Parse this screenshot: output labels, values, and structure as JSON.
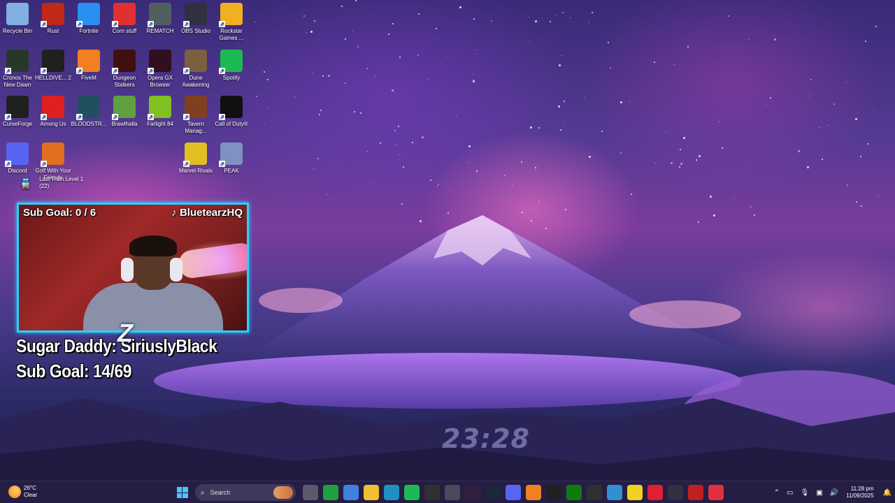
{
  "desktop": {
    "icons": [
      {
        "label": "Recycle Bin",
        "icon": "recycle-bin-icon",
        "color": "#7fb0e0"
      },
      {
        "label": "Rust",
        "icon": "rust-icon",
        "color": "#c02818"
      },
      {
        "label": "Fortnite",
        "icon": "fortnite-icon",
        "color": "#2a8ff0"
      },
      {
        "label": "Corn stuff",
        "icon": "power-icon",
        "color": "#e03030"
      },
      {
        "label": "REMATCH",
        "icon": "rematch-icon",
        "color": "#506060"
      },
      {
        "label": "OBS Studio",
        "icon": "obs-icon",
        "color": "#303040"
      },
      {
        "label": "Rockstar Games ...",
        "icon": "rockstar-icon",
        "color": "#f0b020"
      },
      {
        "label": "Cronos The New Dawn",
        "icon": "cronos-icon",
        "color": "#283828"
      },
      {
        "label": "HELLDIVE... 2",
        "icon": "helldivers-icon",
        "color": "#202020"
      },
      {
        "label": "FiveM",
        "icon": "fivem-icon",
        "color": "#f08020"
      },
      {
        "label": "Dungeon Stalkers",
        "icon": "dungeon-stalkers-icon",
        "color": "#401010"
      },
      {
        "label": "Opera GX Browser",
        "icon": "opera-gx-icon",
        "color": "#301020"
      },
      {
        "label": "Dune Awakening",
        "icon": "dune-icon",
        "color": "#7a6040"
      },
      {
        "label": "Spotify",
        "icon": "spotify-icon",
        "color": "#1db954"
      },
      {
        "label": "CurseForge",
        "icon": "curseforge-icon",
        "color": "#202020"
      },
      {
        "label": "Among Us",
        "icon": "among-us-icon",
        "color": "#e02020"
      },
      {
        "label": "BLOODSTR...",
        "icon": "bloodstrike-icon",
        "color": "#205060"
      },
      {
        "label": "Brawlhalla",
        "icon": "brawlhalla-icon",
        "color": "#60a040"
      },
      {
        "label": "Farlight 84",
        "icon": "farlight-icon",
        "color": "#80c020"
      },
      {
        "label": "Tavern Manag...",
        "icon": "tavern-icon",
        "color": "#804020"
      },
      {
        "label": "Call of Duty®",
        "icon": "call-of-duty-icon",
        "color": "#101010"
      },
      {
        "label": "Discord",
        "icon": "discord-icon",
        "color": "#5865f2"
      },
      {
        "label": "Golf With Your Friends",
        "icon": "golf-icon",
        "color": "#e07020"
      },
      {
        "label": "Marvel Rivals",
        "icon": "marvel-rivals-icon",
        "color": "#e0c020"
      },
      {
        "label": "PEAK",
        "icon": "peak-icon",
        "color": "#8090c0"
      },
      {
        "label": "Last Train Level 1  (22)",
        "icon": "train-icon",
        "color": "#3a3a5a"
      }
    ]
  },
  "stream_overlay": {
    "cam_sub_goal": "Sub Goal:  0 / 6",
    "cam_handle": "♪ BluetearzHQ",
    "line1": "Sugar Daddy: SiriuslyBlack",
    "line2": "Sub Goal: 14/69"
  },
  "wallpaper": {
    "clock": "23:28"
  },
  "taskbar": {
    "weather_temp": "26°C",
    "weather_desc": "Clear",
    "search_label": "Search",
    "pinned": [
      {
        "icon": "task-view-icon",
        "color": "#5a5a6a"
      },
      {
        "icon": "spreadsheet-icon",
        "color": "#20a040"
      },
      {
        "icon": "chrome-icon",
        "color": "#4080e0"
      },
      {
        "icon": "file-explorer-icon",
        "color": "#f0c030"
      },
      {
        "icon": "vscode-icon",
        "color": "#2090c0"
      },
      {
        "icon": "spotify-icon",
        "color": "#1db954"
      },
      {
        "icon": "epic-games-icon",
        "color": "#303030"
      },
      {
        "icon": "notepad-icon",
        "color": "#4a4a5a"
      },
      {
        "icon": "obs-icon",
        "color": "#302040"
      },
      {
        "icon": "steam-icon",
        "color": "#1b2838"
      },
      {
        "icon": "discord-icon",
        "color": "#5865f2"
      },
      {
        "icon": "vlc-icon",
        "color": "#f08020"
      },
      {
        "icon": "capcut-icon",
        "color": "#202020"
      },
      {
        "icon": "xbox-icon",
        "color": "#107c10"
      },
      {
        "icon": "steelseries-icon",
        "color": "#303030"
      },
      {
        "icon": "photos-icon",
        "color": "#3090d0"
      },
      {
        "icon": "sticky-notes-icon",
        "color": "#f0d020"
      },
      {
        "icon": "opera-icon",
        "color": "#e02030"
      },
      {
        "icon": "terminal-icon",
        "color": "#303040"
      },
      {
        "icon": "cc-icon",
        "color": "#c02020"
      },
      {
        "icon": "tf-icon",
        "color": "#e03040"
      }
    ],
    "time": "11:28 pm",
    "date": "11/09/2025"
  }
}
